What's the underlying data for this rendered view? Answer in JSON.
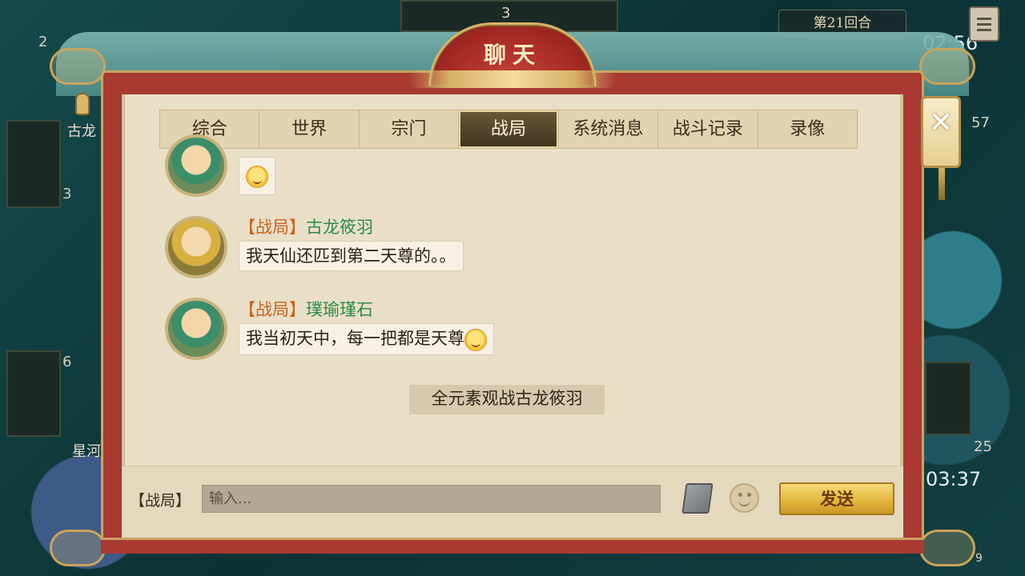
{
  "background": {
    "round_label": "第21回合",
    "timer_top": "02:56",
    "timer_bottom": "03:37",
    "left_top_count": "2",
    "top_center_count": "3",
    "left_player_name": "古龙",
    "left_player_name2": "星河",
    "num_3": "3",
    "num_6": "6",
    "num_57": "57",
    "num_25": "25",
    "num_9": "9"
  },
  "dialog": {
    "title": "聊天",
    "close_label": "✕"
  },
  "tabs": [
    {
      "label": "综合"
    },
    {
      "label": "世界"
    },
    {
      "label": "宗门"
    },
    {
      "label": "战局",
      "active": true
    },
    {
      "label": "系统消息"
    },
    {
      "label": "战斗记录"
    },
    {
      "label": "录像"
    }
  ],
  "messages": [
    {
      "channel": "【战局】",
      "sender": "古龙筱羽",
      "text": "我天仙还匹到第二天尊的。。"
    },
    {
      "channel": "【战局】",
      "sender": "璞瑜瑾石",
      "text": "我当初天中，每一把都是天尊"
    }
  ],
  "system_note": "全元素观战古龙筱羽",
  "input": {
    "channel_label": "【战局】",
    "placeholder": "输入...",
    "send_label": "发送"
  },
  "icons": {
    "emoji": "smiley-emoji-icon",
    "book": "phrasebook-icon",
    "smile": "emoji-picker-icon",
    "close": "close-icon"
  }
}
